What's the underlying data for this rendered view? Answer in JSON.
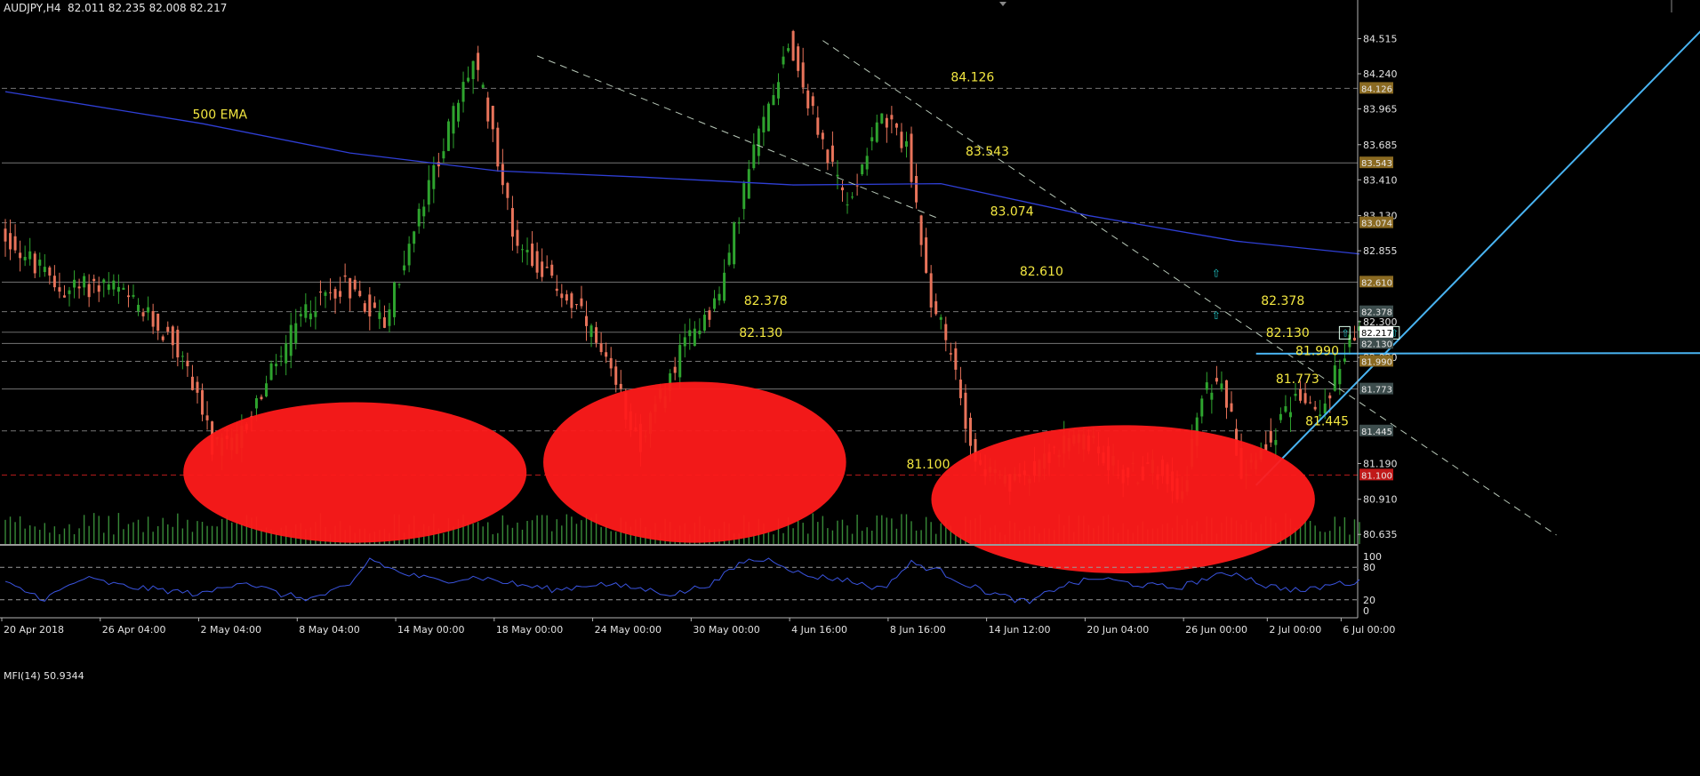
{
  "header": {
    "symbol": "AUDJPY,H4",
    "ohlc": "82.011 82.235 82.008 82.217"
  },
  "indicator": {
    "label": "MFI(14) 50.9344",
    "levels": [
      100,
      80,
      20,
      0
    ],
    "level_labels": [
      "100",
      "80",
      "20",
      "0"
    ]
  },
  "colors": {
    "background": "#000000",
    "axis": "#b4b4b4",
    "bull": "#2ea32e",
    "bear": "#e8735a",
    "volume": "#3f9a3f",
    "ema": "#2f3fd6",
    "trend_light": "#49b4f2",
    "annotation": "#f2e640",
    "circle": "#ff1a1a",
    "mfi_line": "#3a54e0"
  },
  "chart_data": {
    "type": "line",
    "title": "",
    "x_tick_labels": [
      "20 Apr 2018",
      "26 Apr 04:00",
      "2 May 04:00",
      "8 May 04:00",
      "14 May 00:00",
      "18 May 00:00",
      "24 May 00:00",
      "30 May 00:00",
      "4 Jun 16:00",
      "8 Jun 16:00",
      "14 Jun 12:00",
      "20 Jun 04:00",
      "26 Jun 00:00",
      "2 Jul 00:00",
      "6 Jul 00:00"
    ],
    "y_ticks": [
      84.515,
      84.24,
      83.965,
      83.685,
      83.41,
      83.13,
      82.855,
      82.3,
      82.02,
      81.19,
      80.91,
      80.635
    ],
    "ylim": [
      80.56,
      84.72
    ],
    "price_path": [
      [
        0,
        83.0
      ],
      [
        12,
        82.55
      ],
      [
        22,
        82.6
      ],
      [
        28,
        82.4
      ],
      [
        35,
        82.15
      ],
      [
        40,
        81.75
      ],
      [
        43,
        81.3
      ],
      [
        48,
        81.35
      ],
      [
        55,
        81.9
      ],
      [
        62,
        82.4
      ],
      [
        70,
        82.6
      ],
      [
        78,
        82.3
      ],
      [
        84,
        83.0
      ],
      [
        90,
        83.7
      ],
      [
        96,
        84.35
      ],
      [
        100,
        83.8
      ],
      [
        104,
        83.0
      ],
      [
        110,
        82.7
      ],
      [
        118,
        82.35
      ],
      [
        126,
        81.7
      ],
      [
        130,
        81.35
      ],
      [
        134,
        81.7
      ],
      [
        140,
        82.2
      ],
      [
        146,
        82.5
      ],
      [
        152,
        83.5
      ],
      [
        160,
        84.5
      ],
      [
        166,
        83.8
      ],
      [
        172,
        83.2
      ],
      [
        178,
        83.9
      ],
      [
        184,
        83.7
      ],
      [
        188,
        82.6
      ],
      [
        194,
        81.9
      ],
      [
        198,
        81.2
      ],
      [
        205,
        81.0
      ],
      [
        212,
        81.25
      ],
      [
        220,
        81.4
      ],
      [
        228,
        81.1
      ],
      [
        236,
        81.15
      ],
      [
        240,
        80.95
      ],
      [
        244,
        81.7
      ],
      [
        248,
        81.9
      ],
      [
        252,
        81.15
      ],
      [
        258,
        81.4
      ],
      [
        264,
        81.75
      ],
      [
        268,
        81.55
      ],
      [
        272,
        82.0
      ],
      [
        275,
        82.2
      ]
    ],
    "ema": {
      "name": "500 EMA",
      "path": [
        [
          0,
          84.1
        ],
        [
          40,
          83.85
        ],
        [
          70,
          83.62
        ],
        [
          100,
          83.48
        ],
        [
          130,
          83.43
        ],
        [
          160,
          83.37
        ],
        [
          190,
          83.38
        ],
        [
          220,
          83.13
        ],
        [
          250,
          82.93
        ],
        [
          275,
          82.83
        ]
      ]
    },
    "horizontal_levels": [
      84.126,
      83.543,
      83.074,
      82.61,
      82.378,
      82.13,
      81.99,
      81.773,
      81.445,
      81.1
    ],
    "level_tags": [
      "84.126",
      "83.543",
      "83.074",
      "82.610",
      "82.378",
      "82.130",
      "81.990",
      "81.773",
      "81.445",
      "81.100"
    ],
    "current_price_tag": "82.217",
    "annotations": [
      {
        "text": "84.126",
        "x": 192,
        "y": 84.18
      },
      {
        "text": "83.543",
        "x": 195,
        "y": 83.6
      },
      {
        "text": "83.074",
        "x": 200,
        "y": 83.13
      },
      {
        "text": "82.610",
        "x": 206,
        "y": 82.66
      },
      {
        "text": "82.378",
        "x": 150,
        "y": 82.43
      },
      {
        "text": "82.130",
        "x": 149,
        "y": 82.18
      },
      {
        "text": "82.378",
        "x": 255,
        "y": 82.43
      },
      {
        "text": "82.130",
        "x": 256,
        "y": 82.18
      },
      {
        "text": "81.990",
        "x": 262,
        "y": 82.04
      },
      {
        "text": "81.773",
        "x": 258,
        "y": 81.82
      },
      {
        "text": "81.445",
        "x": 264,
        "y": 81.49
      },
      {
        "text": "81.100",
        "x": 183,
        "y": 81.15
      },
      {
        "text": "500 EMA",
        "x": 38,
        "y": 83.89
      }
    ],
    "trendlines": [
      {
        "style": "dashed",
        "from": [
          108,
          84.38
        ],
        "to": [
          190,
          83.1
        ]
      },
      {
        "style": "dashed",
        "from": [
          166,
          84.5
        ],
        "to": [
          315,
          80.63
        ]
      },
      {
        "style": "solid",
        "from": [
          254,
          81.02
        ],
        "to": [
          348,
          84.72
        ]
      },
      {
        "style": "solid",
        "from": [
          254,
          82.05
        ],
        "to": [
          372,
          82.055
        ]
      }
    ],
    "circles": [
      {
        "cx": 71,
        "cy": 81.12,
        "rx": 17,
        "ry": 0.55
      },
      {
        "cx": 140,
        "cy": 81.2,
        "rx": 15,
        "ry": 0.63
      },
      {
        "cx": 227,
        "cy": 80.91,
        "rx": 19,
        "ry": 0.58
      }
    ],
    "volume_scale": 35,
    "mfi": {
      "name": "MFI(14)",
      "ylim": [
        0,
        100
      ],
      "path": [
        [
          0,
          50
        ],
        [
          8,
          22
        ],
        [
          16,
          60
        ],
        [
          24,
          45
        ],
        [
          32,
          38
        ],
        [
          40,
          30
        ],
        [
          48,
          55
        ],
        [
          56,
          30
        ],
        [
          62,
          22
        ],
        [
          70,
          45
        ],
        [
          74,
          96
        ],
        [
          80,
          70
        ],
        [
          88,
          55
        ],
        [
          96,
          62
        ],
        [
          104,
          48
        ],
        [
          112,
          38
        ],
        [
          120,
          50
        ],
        [
          128,
          42
        ],
        [
          136,
          30
        ],
        [
          144,
          52
        ],
        [
          150,
          92
        ],
        [
          156,
          94
        ],
        [
          162,
          65
        ],
        [
          170,
          58
        ],
        [
          178,
          40
        ],
        [
          184,
          88
        ],
        [
          190,
          72
        ],
        [
          196,
          45
        ],
        [
          202,
          28
        ],
        [
          208,
          14
        ],
        [
          214,
          45
        ],
        [
          222,
          60
        ],
        [
          230,
          48
        ],
        [
          238,
          42
        ],
        [
          244,
          60
        ],
        [
          250,
          70
        ],
        [
          256,
          46
        ],
        [
          264,
          36
        ],
        [
          270,
          50
        ],
        [
          275,
          52
        ]
      ]
    }
  }
}
